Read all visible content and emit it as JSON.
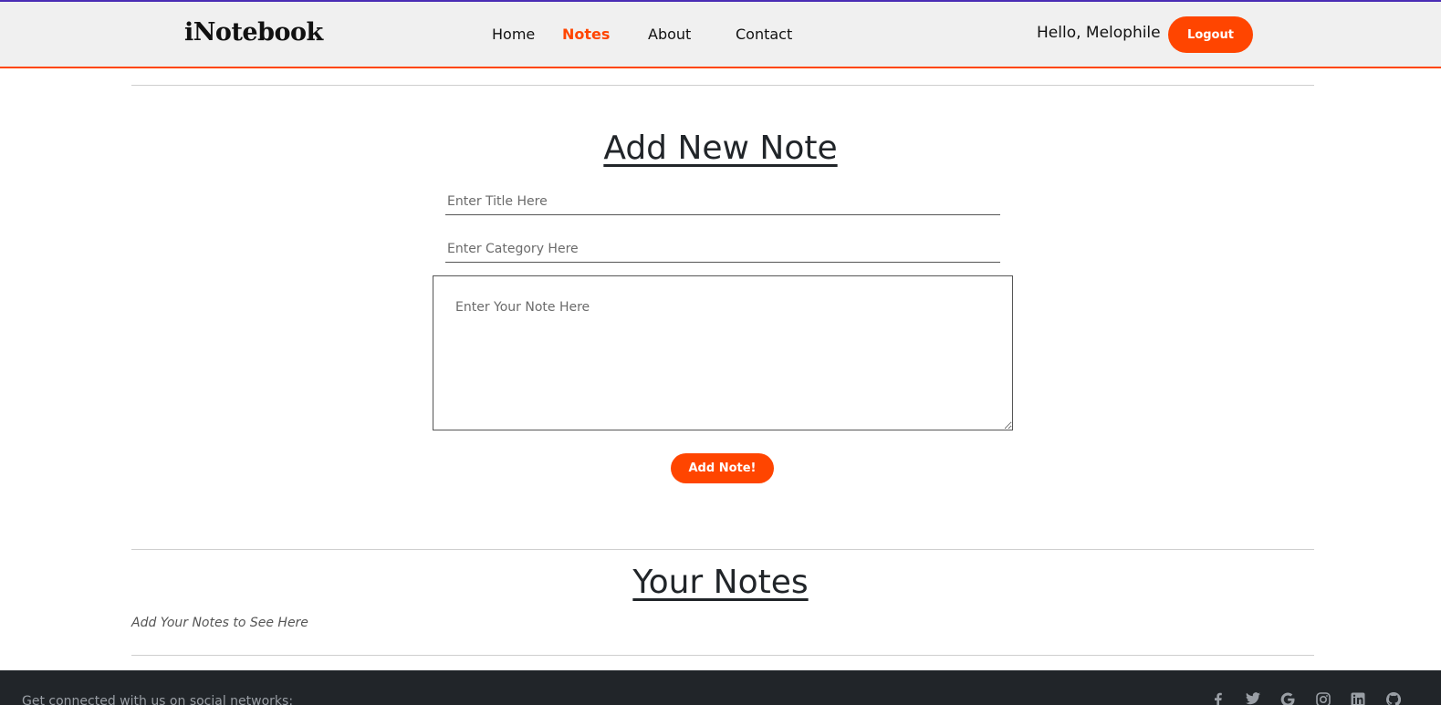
{
  "navbar": {
    "brand": "iNotebook",
    "links": [
      {
        "label": "Home",
        "active": false
      },
      {
        "label": "Notes",
        "active": true
      },
      {
        "label": "About",
        "active": false
      },
      {
        "label": "Contact",
        "active": false
      }
    ],
    "greeting": "Hello, Melophile",
    "logout_label": "Logout"
  },
  "add_note": {
    "heading": "Add New Note",
    "title_placeholder": "Enter Title Here",
    "category_placeholder": "Enter Category Here",
    "note_placeholder": "Enter Your Note Here",
    "submit_label": "Add Note!"
  },
  "your_notes": {
    "heading": "Your Notes",
    "empty_message": "Add Your Notes to See Here"
  },
  "footer": {
    "text": "Get connected with us on social networks:",
    "social_icons": [
      "facebook-icon",
      "twitter-icon",
      "google-icon",
      "instagram-icon",
      "linkedin-icon",
      "github-icon"
    ]
  },
  "colors": {
    "accent": "#ff4500",
    "footer_bg": "#212529",
    "navbar_bg": "#f0f0f0"
  }
}
